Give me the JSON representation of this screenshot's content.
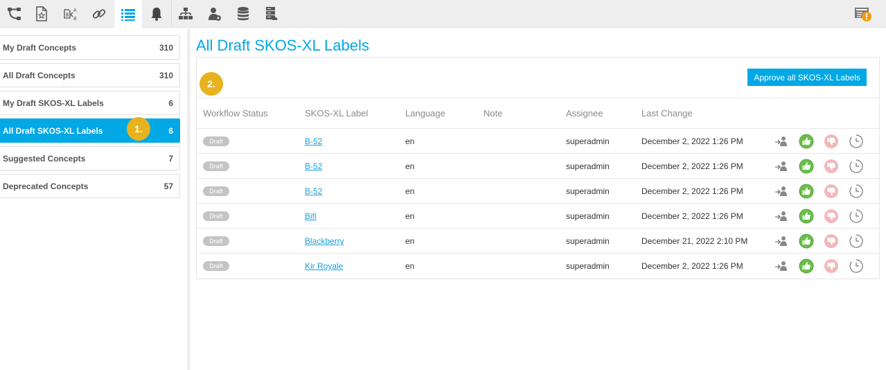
{
  "toolbar": {
    "items": [
      {
        "name": "hierarchy",
        "icon": "tree-branch-icon",
        "active": false
      },
      {
        "name": "favorites",
        "icon": "document-star-icon",
        "active": false
      },
      {
        "name": "labels",
        "icon": "document-ab-icon",
        "active": false
      },
      {
        "name": "links",
        "icon": "link-icon",
        "active": false
      },
      {
        "name": "list",
        "icon": "list-icon",
        "active": true
      },
      {
        "name": "notifications",
        "icon": "bell-icon",
        "active": false
      },
      {
        "name": "sitemap",
        "icon": "sitemap-icon",
        "active": false
      },
      {
        "name": "user-settings",
        "icon": "user-gear-icon",
        "active": false
      },
      {
        "name": "database",
        "icon": "database-icon",
        "active": false
      },
      {
        "name": "server",
        "icon": "server-cloud-icon",
        "active": false
      }
    ],
    "notification_icon": "alert-list-icon",
    "accent_color": "#00a8e6",
    "alert_color": "#f39c12"
  },
  "sidebar": {
    "items": [
      {
        "label": "My Draft Concepts",
        "count": "310",
        "active": false
      },
      {
        "label": "All Draft Concepts",
        "count": "310",
        "active": false
      },
      {
        "label": "My Draft SKOS-XL Labels",
        "count": "6",
        "active": false
      },
      {
        "label": "All Draft SKOS-XL Labels",
        "count": "6",
        "active": true
      },
      {
        "label": "Suggested Concepts",
        "count": "7",
        "active": false
      },
      {
        "label": "Deprecated Concepts",
        "count": "57",
        "active": false
      }
    ]
  },
  "callouts": {
    "one": "1.",
    "two": "2."
  },
  "main": {
    "title": "All Draft SKOS-XL Labels",
    "approve_all_label": "Approve all SKOS-XL Labels",
    "columns": [
      "Workflow Status",
      "SKOS-XL Label",
      "Language",
      "Note",
      "Assignee",
      "Last Change"
    ],
    "rows": [
      {
        "status": "Draft",
        "label": "B-52",
        "language": "en",
        "note": "",
        "assignee": "superadmin",
        "last_change": "December 2, 2022 1:26 PM"
      },
      {
        "status": "Draft",
        "label": "B-52",
        "language": "en",
        "note": "",
        "assignee": "superadmin",
        "last_change": "December 2, 2022 1:26 PM"
      },
      {
        "status": "Draft",
        "label": "B-52",
        "language": "en",
        "note": "",
        "assignee": "superadmin",
        "last_change": "December 2, 2022 1:26 PM"
      },
      {
        "status": "Draft",
        "label": "Bifi",
        "language": "en",
        "note": "",
        "assignee": "superadmin",
        "last_change": "December 2, 2022 1:26 PM"
      },
      {
        "status": "Draft",
        "label": "Blackberry",
        "language": "en",
        "note": "",
        "assignee": "superadmin",
        "last_change": "December 21, 2022 2:10 PM"
      },
      {
        "status": "Draft",
        "label": "Kir Royale",
        "language": "en",
        "note": "",
        "assignee": "superadmin",
        "last_change": "December 2, 2022 1:26 PM"
      }
    ],
    "row_actions": [
      {
        "name": "assign",
        "icon": "assign-user-icon"
      },
      {
        "name": "approve",
        "icon": "thumbs-up-icon",
        "color": "#6abf4b"
      },
      {
        "name": "reject",
        "icon": "thumbs-down-icon",
        "color": "#f2b8b8"
      },
      {
        "name": "history",
        "icon": "clock-icon"
      }
    ]
  }
}
